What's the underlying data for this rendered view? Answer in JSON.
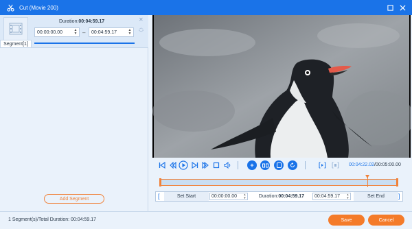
{
  "window": {
    "title": "Cut (Movie 200)",
    "icons": {
      "app": "scissors-icon",
      "maximize": "maximize-icon",
      "close": "close-icon"
    }
  },
  "segment": {
    "label": "Segment[1]",
    "duration_label": "Duration:",
    "duration_value": "00:04:59.17",
    "start_time": "00:00:00.00",
    "end_time": "00:04:59.17",
    "separator": "–",
    "thumbnail_icon": "film-strip-icon"
  },
  "left_panel": {
    "add_segment_label": "Add Segment"
  },
  "controls": {
    "current_time": "00:04:22.02",
    "total_time": "/00:05:00.00",
    "icons": [
      "go-to-start-icon",
      "step-back-icon",
      "play-icon",
      "step-forward-icon",
      "go-to-end-icon",
      "stop-icon",
      "volume-icon",
      "add-icon",
      "split-icon",
      "copy-icon",
      "reset-icon",
      "mark-in-icon",
      "mark-out-icon"
    ]
  },
  "timeline": {
    "playhead_fraction": 0.8734
  },
  "set_bar": {
    "set_start_label": "Set Start",
    "start_time": "00:00:00.00",
    "duration_label": "Duration:",
    "duration_value": "00:04:59.17",
    "end_time": "00:04:59.17",
    "set_end_label": "Set End",
    "bracket_left": "[",
    "bracket_right": "]"
  },
  "footer": {
    "status": "1 Segment(s)/Total Duration: 00:04:59.17",
    "save_label": "Save",
    "cancel_label": "Cancel"
  },
  "colors": {
    "accent": "#1a73e8",
    "orange": "#f47b2a",
    "background": "#eaf2fb"
  }
}
